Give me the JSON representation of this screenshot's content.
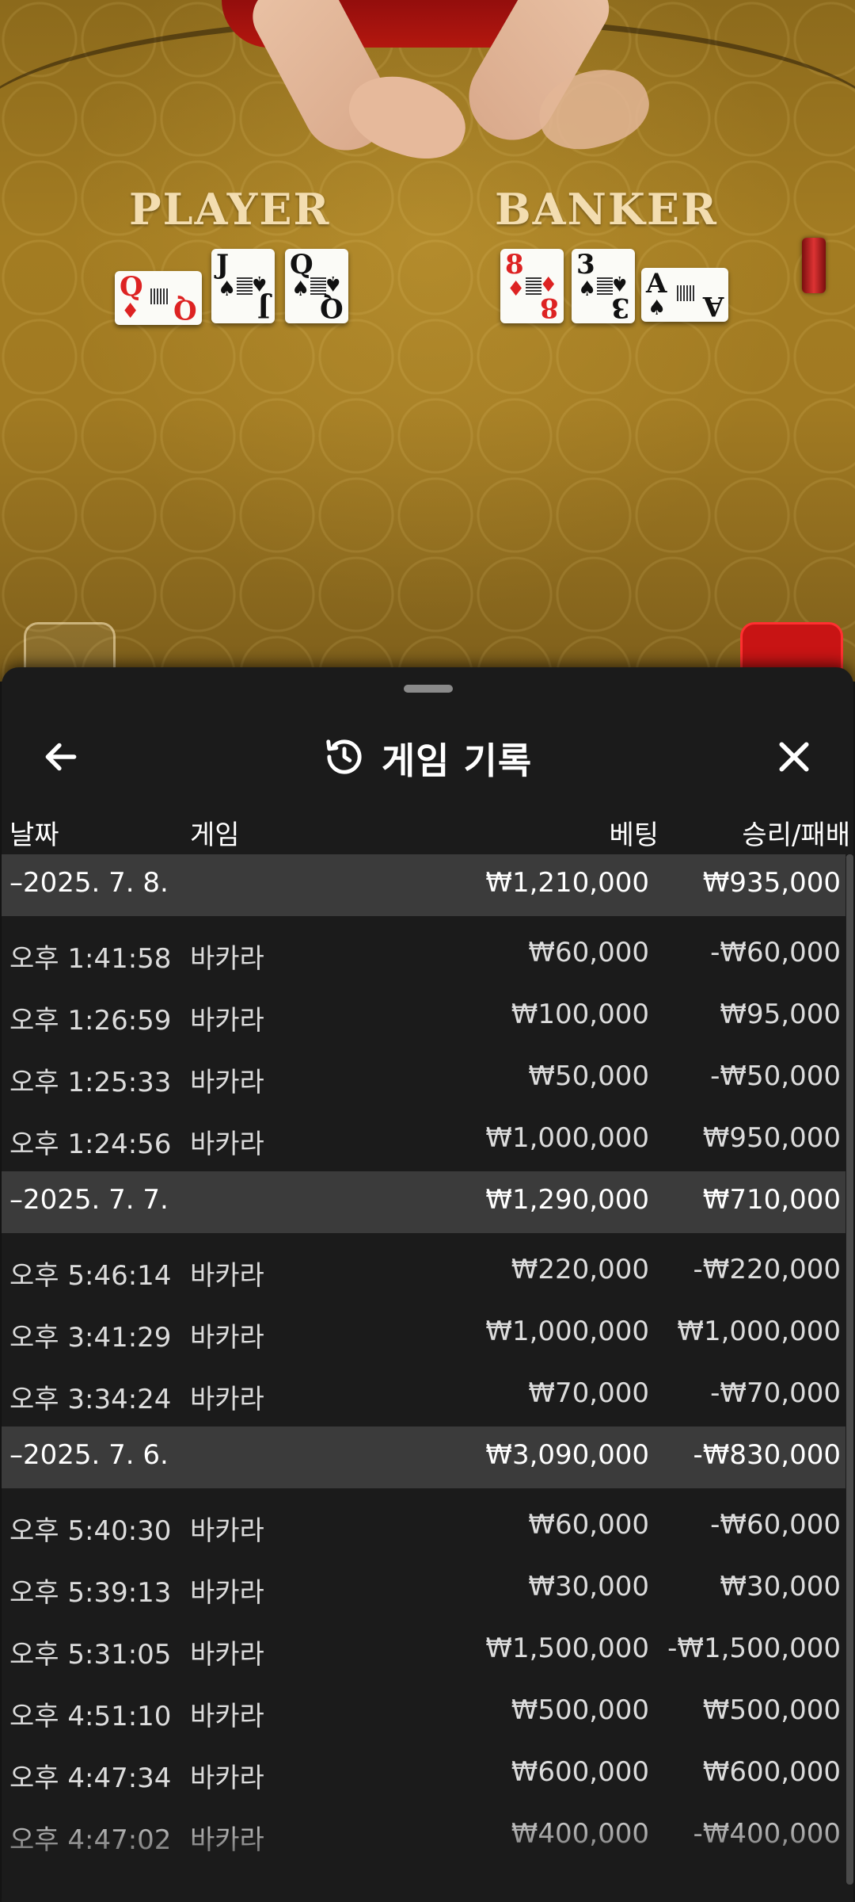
{
  "table": {
    "player_label": "PLAYER",
    "banker_label": "BANKER",
    "player_cards": [
      {
        "rank": "Q",
        "suit": "♦",
        "color": "red",
        "sideways": true
      },
      {
        "rank": "J",
        "suit": "♠",
        "color": "black",
        "sideways": false
      },
      {
        "rank": "Q",
        "suit": "♠",
        "color": "black",
        "sideways": false
      }
    ],
    "banker_cards": [
      {
        "rank": "8",
        "suit": "♦",
        "color": "red",
        "sideways": false
      },
      {
        "rank": "3",
        "suit": "♠",
        "color": "black",
        "sideways": false
      },
      {
        "rank": "A",
        "suit": "♠",
        "color": "black",
        "sideways": true
      }
    ]
  },
  "sheet": {
    "title": "게임 기록",
    "icons": {
      "back": "arrow-left-icon",
      "history": "history-icon",
      "close": "close-icon"
    },
    "columns": {
      "date": "날짜",
      "game": "게임",
      "bet": "베팅",
      "result": "승리/패배"
    },
    "groups": [
      {
        "date": "–2025. 7. 8.",
        "bet_total": "₩1,210,000",
        "result_total": "₩935,000",
        "rows": [
          {
            "time": "오후 1:41:58",
            "game": "바카라",
            "bet": "₩60,000",
            "result": "-₩60,000"
          },
          {
            "time": "오후 1:26:59",
            "game": "바카라",
            "bet": "₩100,000",
            "result": "₩95,000"
          },
          {
            "time": "오후 1:25:33",
            "game": "바카라",
            "bet": "₩50,000",
            "result": "-₩50,000"
          },
          {
            "time": "오후 1:24:56",
            "game": "바카라",
            "bet": "₩1,000,000",
            "result": "₩950,000"
          }
        ]
      },
      {
        "date": "–2025. 7. 7.",
        "bet_total": "₩1,290,000",
        "result_total": "₩710,000",
        "rows": [
          {
            "time": "오후 5:46:14",
            "game": "바카라",
            "bet": "₩220,000",
            "result": "-₩220,000"
          },
          {
            "time": "오후 3:41:29",
            "game": "바카라",
            "bet": "₩1,000,000",
            "result": "₩1,000,000"
          },
          {
            "time": "오후 3:34:24",
            "game": "바카라",
            "bet": "₩70,000",
            "result": "-₩70,000"
          }
        ]
      },
      {
        "date": "–2025. 7. 6.",
        "bet_total": "₩3,090,000",
        "result_total": "-₩830,000",
        "rows": [
          {
            "time": "오후 5:40:30",
            "game": "바카라",
            "bet": "₩60,000",
            "result": "-₩60,000"
          },
          {
            "time": "오후 5:39:13",
            "game": "바카라",
            "bet": "₩30,000",
            "result": "₩30,000"
          },
          {
            "time": "오후 5:31:05",
            "game": "바카라",
            "bet": "₩1,500,000",
            "result": "-₩1,500,000"
          },
          {
            "time": "오후 4:51:10",
            "game": "바카라",
            "bet": "₩500,000",
            "result": "₩500,000"
          },
          {
            "time": "오후 4:47:34",
            "game": "바카라",
            "bet": "₩600,000",
            "result": "₩600,000"
          },
          {
            "time": "오후 4:47:02",
            "game": "바카라",
            "bet": "₩400,000",
            "result": "-₩400,000"
          }
        ]
      }
    ]
  }
}
